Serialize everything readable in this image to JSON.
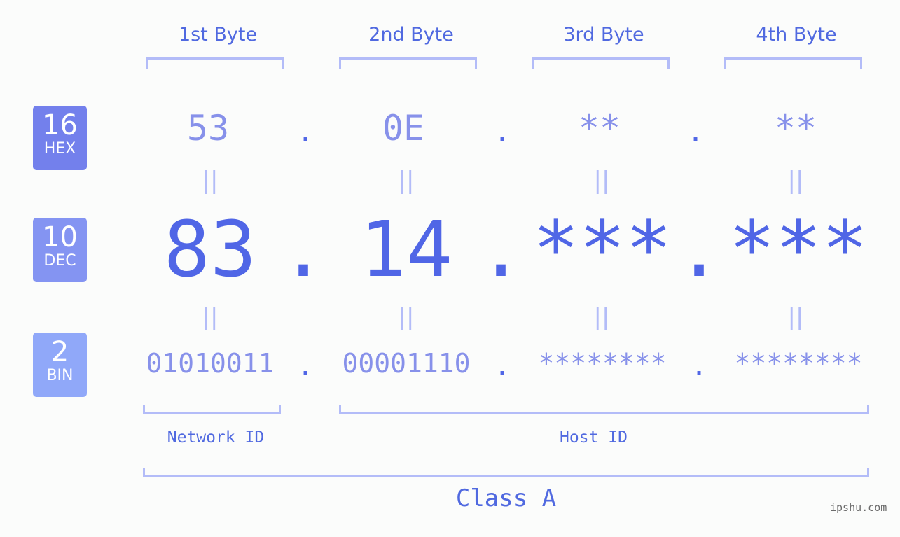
{
  "headers": [
    "1st Byte",
    "2nd Byte",
    "3rd Byte",
    "4th Byte"
  ],
  "badges": {
    "hex": {
      "num": "16",
      "label": "HEX",
      "color": "#7380ec"
    },
    "dec": {
      "num": "10",
      "label": "DEC",
      "color": "#8494f2"
    },
    "bin": {
      "num": "2",
      "label": "BIN",
      "color": "#90a8f9"
    }
  },
  "hex_values": [
    "53",
    "0E",
    "**",
    "**"
  ],
  "dec_values": [
    "83",
    "14",
    "***",
    "***"
  ],
  "bin_values": [
    "01010011",
    "00001110",
    "********",
    "********"
  ],
  "separator": ".",
  "equals": "||",
  "network_label": "Network ID",
  "host_label": "Host ID",
  "class_label": "Class A",
  "watermark": "ipshu.com"
}
